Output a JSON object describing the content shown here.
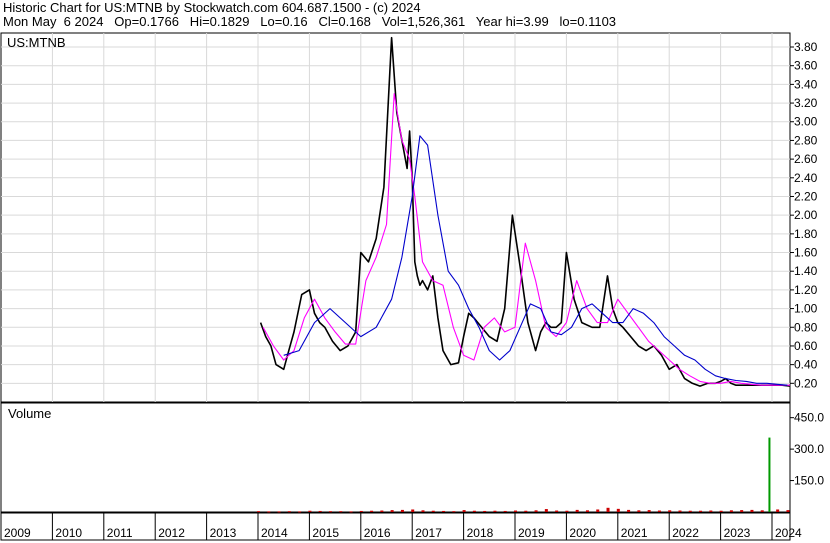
{
  "header": {
    "line1": "Historic Chart for US:MTNB by Stockwatch.com 604.687.1500 - (c) 2024",
    "line2": "Mon May  6 2024   Op=0.1766   Hi=0.1829   Lo=0.16   Cl=0.168   Vol=1,526,361   Year hi=3.99   lo=0.1103"
  },
  "chart_data": [
    {
      "type": "line",
      "title": "US:MTNB",
      "ylim": [
        0,
        3.95
      ],
      "y_ticks": [
        "3.80",
        "3.60",
        "3.40",
        "3.20",
        "3.00",
        "2.80",
        "2.60",
        "2.40",
        "2.20",
        "2.00",
        "1.80",
        "1.60",
        "1.40",
        "1.20",
        "1.00",
        "0.80",
        "0.60",
        "0.40",
        "0.20"
      ],
      "x_labels": [
        "2009",
        "2010",
        "2011",
        "2012",
        "2013",
        "2014",
        "2015",
        "2016",
        "2017",
        "2018",
        "2019",
        "2020",
        "2021",
        "2022",
        "2023",
        "2024"
      ],
      "grid": true,
      "colors": {
        "price": "#000000",
        "ma_short": "#ff00ff",
        "ma_long": "#0000cc"
      },
      "series": [
        {
          "x": [
            2014.05,
            2014.15,
            2014.25,
            2014.35,
            2014.5,
            2014.6,
            2014.7,
            2014.85,
            2015.0,
            2015.1,
            2015.2,
            2015.3,
            2015.45,
            2015.6,
            2015.75,
            2015.9,
            2016.0,
            2016.15,
            2016.3,
            2016.45,
            2016.6,
            2016.7,
            2016.8,
            2016.9,
            2016.95,
            2017.0,
            2017.05,
            2017.1,
            2017.15,
            2017.2,
            2017.3,
            2017.4,
            2017.5,
            2017.6,
            2017.75,
            2017.9,
            2018.0,
            2018.1,
            2018.2,
            2018.35,
            2018.5,
            2018.65,
            2018.8,
            2018.95,
            2019.1,
            2019.25,
            2019.4,
            2019.5,
            2019.6,
            2019.7,
            2019.8,
            2019.9,
            2020.0,
            2020.15,
            2020.3,
            2020.5,
            2020.65,
            2020.8,
            2020.9,
            2021.0,
            2021.1,
            2021.25,
            2021.4,
            2021.55,
            2021.7,
            2021.85,
            2022.0,
            2022.15,
            2022.3,
            2022.45,
            2022.6,
            2022.75,
            2022.9,
            2023.0,
            2023.1,
            2023.2,
            2023.3,
            2023.45,
            2023.6,
            2023.75,
            2023.9,
            2024.0,
            2024.1,
            2024.2,
            2024.35
          ],
          "values": [
            0.85,
            0.7,
            0.6,
            0.4,
            0.35,
            0.55,
            0.75,
            1.15,
            1.2,
            0.95,
            0.85,
            0.8,
            0.65,
            0.55,
            0.6,
            0.75,
            1.6,
            1.5,
            1.75,
            2.3,
            3.9,
            3.1,
            2.8,
            2.5,
            2.9,
            2.4,
            1.5,
            1.35,
            1.25,
            1.3,
            1.2,
            1.35,
            0.9,
            0.55,
            0.4,
            0.42,
            0.7,
            0.95,
            0.9,
            0.8,
            0.7,
            0.65,
            1.0,
            2.0,
            1.45,
            0.85,
            0.55,
            0.75,
            0.85,
            0.8,
            0.8,
            0.85,
            1.6,
            1.1,
            0.85,
            0.8,
            0.8,
            1.35,
            1.0,
            0.85,
            0.8,
            0.7,
            0.6,
            0.55,
            0.6,
            0.5,
            0.35,
            0.4,
            0.25,
            0.2,
            0.17,
            0.2,
            0.2,
            0.22,
            0.25,
            0.2,
            0.18,
            0.18,
            0.18,
            0.18,
            0.18,
            0.18,
            0.18,
            0.18,
            0.17
          ]
        },
        {
          "x": [
            2014.1,
            2014.3,
            2014.5,
            2014.7,
            2014.9,
            2015.1,
            2015.3,
            2015.5,
            2015.7,
            2015.9,
            2016.1,
            2016.3,
            2016.5,
            2016.65,
            2016.8,
            2016.95,
            2017.05,
            2017.2,
            2017.4,
            2017.6,
            2017.8,
            2018.0,
            2018.2,
            2018.4,
            2018.6,
            2018.8,
            2019.0,
            2019.2,
            2019.4,
            2019.6,
            2019.8,
            2020.0,
            2020.2,
            2020.4,
            2020.6,
            2020.8,
            2021.0,
            2021.2,
            2021.4,
            2021.6,
            2021.8,
            2022.0,
            2022.2,
            2022.4,
            2022.6,
            2022.8,
            2023.0,
            2023.2,
            2023.4,
            2023.6,
            2023.8,
            2024.0,
            2024.2,
            2024.35
          ],
          "values": [
            0.8,
            0.6,
            0.45,
            0.55,
            0.9,
            1.1,
            0.9,
            0.75,
            0.62,
            0.62,
            1.3,
            1.55,
            1.9,
            3.3,
            2.8,
            2.6,
            2.2,
            1.5,
            1.3,
            1.25,
            0.8,
            0.5,
            0.45,
            0.8,
            0.9,
            0.75,
            0.8,
            1.7,
            1.3,
            0.8,
            0.7,
            0.85,
            1.3,
            1.0,
            0.85,
            0.85,
            1.1,
            0.95,
            0.8,
            0.65,
            0.55,
            0.45,
            0.35,
            0.28,
            0.22,
            0.2,
            0.2,
            0.22,
            0.2,
            0.19,
            0.18,
            0.18,
            0.18,
            0.18
          ]
        },
        {
          "x": [
            2014.5,
            2014.8,
            2015.1,
            2015.4,
            2015.7,
            2016.0,
            2016.3,
            2016.6,
            2016.8,
            2017.0,
            2017.15,
            2017.3,
            2017.5,
            2017.7,
            2017.9,
            2018.1,
            2018.3,
            2018.5,
            2018.7,
            2018.9,
            2019.1,
            2019.3,
            2019.5,
            2019.7,
            2019.9,
            2020.1,
            2020.3,
            2020.5,
            2020.7,
            2020.9,
            2021.1,
            2021.3,
            2021.5,
            2021.7,
            2021.9,
            2022.1,
            2022.3,
            2022.5,
            2022.7,
            2022.9,
            2023.1,
            2023.3,
            2023.5,
            2023.7,
            2023.9,
            2024.1,
            2024.3
          ],
          "values": [
            0.5,
            0.55,
            0.85,
            1.0,
            0.85,
            0.7,
            0.8,
            1.1,
            1.55,
            2.2,
            2.85,
            2.75,
            2.0,
            1.4,
            1.25,
            1.0,
            0.8,
            0.55,
            0.45,
            0.55,
            0.8,
            1.05,
            1.0,
            0.75,
            0.72,
            0.8,
            1.0,
            1.05,
            0.95,
            0.85,
            0.85,
            1.0,
            0.95,
            0.85,
            0.7,
            0.6,
            0.5,
            0.45,
            0.35,
            0.28,
            0.25,
            0.23,
            0.22,
            0.2,
            0.2,
            0.19,
            0.18
          ]
        }
      ]
    },
    {
      "type": "bar",
      "title": "Volume",
      "ylim": [
        0,
        520
      ],
      "y_ticks": [
        "450.0",
        "300.0",
        "150.0"
      ],
      "colors": {
        "bar": "#cc0000",
        "spike": "#009900"
      },
      "x": [
        2014.0,
        2014.2,
        2014.4,
        2014.6,
        2014.8,
        2015.0,
        2015.2,
        2015.4,
        2015.6,
        2015.8,
        2016.0,
        2016.2,
        2016.4,
        2016.6,
        2016.8,
        2017.0,
        2017.2,
        2017.4,
        2017.6,
        2017.8,
        2018.0,
        2018.2,
        2018.4,
        2018.6,
        2018.8,
        2019.0,
        2019.2,
        2019.4,
        2019.6,
        2019.8,
        2020.0,
        2020.2,
        2020.4,
        2020.6,
        2020.8,
        2021.0,
        2021.2,
        2021.4,
        2021.6,
        2021.8,
        2022.0,
        2022.2,
        2022.4,
        2022.6,
        2022.8,
        2023.0,
        2023.2,
        2023.4,
        2023.6,
        2023.8,
        2023.95,
        2024.1,
        2024.3
      ],
      "values": [
        4,
        3,
        3,
        4,
        3,
        6,
        5,
        4,
        4,
        3,
        5,
        6,
        7,
        9,
        10,
        12,
        8,
        6,
        5,
        4,
        9,
        6,
        5,
        6,
        5,
        7,
        6,
        8,
        14,
        7,
        6,
        10,
        8,
        12,
        20,
        15,
        10,
        8,
        9,
        7,
        8,
        7,
        6,
        6,
        7,
        6,
        8,
        9,
        10,
        8,
        355,
        12,
        9
      ]
    }
  ]
}
